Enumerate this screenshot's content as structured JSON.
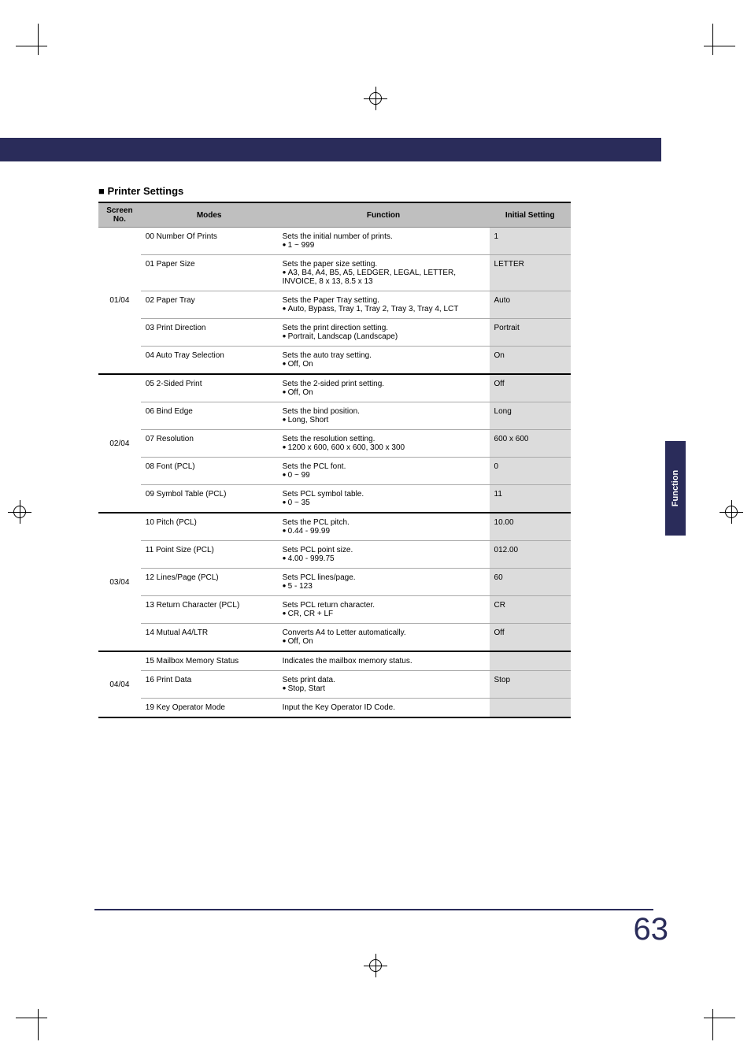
{
  "side_tab": "Function",
  "page_number": "63",
  "section_title": "■ Printer Settings",
  "headers": {
    "screen": "Screen No.",
    "modes": "Modes",
    "function": "Function",
    "initial": "Initial Setting"
  },
  "groups": [
    {
      "screen": "01/04",
      "rows": [
        {
          "mode": "00 Number Of Prints",
          "func": "Sets the initial number of prints.",
          "opts": "1 ~ 999",
          "initial": "1"
        },
        {
          "mode": "01 Paper Size",
          "func": "Sets the paper size setting.",
          "opts": "A3, B4, A4, B5, A5, LEDGER, LEGAL, LETTER, INVOICE, 8 x 13, 8.5 x 13",
          "initial": "LETTER"
        },
        {
          "mode": "02 Paper Tray",
          "func": "Sets the Paper Tray setting.",
          "opts": "Auto, Bypass, Tray 1, Tray 2, Tray 3, Tray 4, LCT",
          "initial": "Auto"
        },
        {
          "mode": "03 Print Direction",
          "func": "Sets the print direction setting.",
          "opts": "Portrait, Landscap (Landscape)",
          "initial": "Portrait"
        },
        {
          "mode": "04 Auto Tray Selection",
          "func": "Sets the auto tray setting.",
          "opts": "Off, On",
          "initial": "On"
        }
      ]
    },
    {
      "screen": "02/04",
      "rows": [
        {
          "mode": "05 2-Sided Print",
          "func": "Sets the 2-sided print setting.",
          "opts": "Off, On",
          "initial": "Off"
        },
        {
          "mode": "06 Bind Edge",
          "func": "Sets the bind position.",
          "opts": "Long, Short",
          "initial": "Long"
        },
        {
          "mode": "07 Resolution",
          "func": "Sets the resolution setting.",
          "opts": "1200 x 600, 600 x 600, 300 x 300",
          "initial": "600 x 600"
        },
        {
          "mode": "08 Font (PCL)",
          "func": "Sets the PCL font.",
          "opts": "0 ~ 99",
          "initial": "0"
        },
        {
          "mode": "09 Symbol Table (PCL)",
          "func": "Sets PCL symbol table.",
          "opts": "0 ~ 35",
          "initial": "11"
        }
      ]
    },
    {
      "screen": "03/04",
      "rows": [
        {
          "mode": "10 Pitch (PCL)",
          "func": "Sets the PCL pitch.",
          "opts": "0.44 - 99.99",
          "initial": "10.00"
        },
        {
          "mode": "11 Point Size (PCL)",
          "func": "Sets PCL point size.",
          "opts": "4.00 - 999.75",
          "initial": "012.00"
        },
        {
          "mode": "12 Lines/Page (PCL)",
          "func": "Sets PCL lines/page.",
          "opts": "5 - 123",
          "initial": "60"
        },
        {
          "mode": "13 Return Character (PCL)",
          "func": "Sets PCL return character.",
          "opts": "CR, CR + LF",
          "initial": "CR"
        },
        {
          "mode": "14 Mutual A4/LTR",
          "func": "Converts A4 to Letter automatically.",
          "opts": "Off, On",
          "initial": "Off"
        }
      ]
    },
    {
      "screen": "04/04",
      "rows": [
        {
          "mode": "15 Mailbox Memory Status",
          "func": "Indicates the mailbox memory status.",
          "opts": "",
          "initial": ""
        },
        {
          "mode": "16 Print Data",
          "func": "Sets print data.",
          "opts": "Stop, Start",
          "initial": "Stop"
        },
        {
          "mode": "19 Key Operator Mode",
          "func": "Input the Key Operator ID Code.",
          "opts": "",
          "initial": ""
        }
      ]
    }
  ]
}
